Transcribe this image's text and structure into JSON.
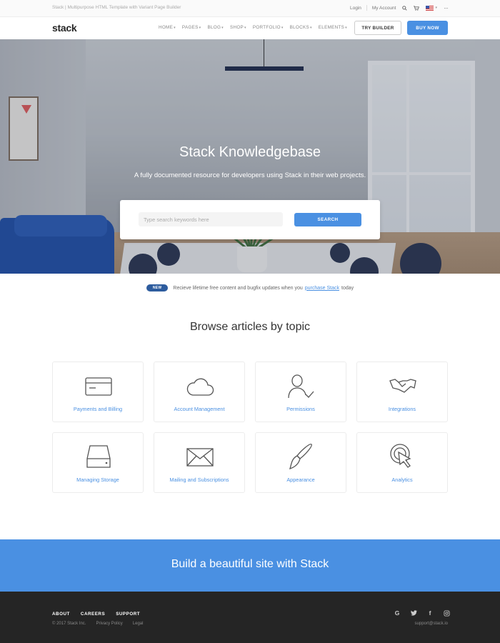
{
  "utility_bar": {
    "tagline": "Stack | Multipurpose HTML Template with Variant Page Builder",
    "login": "Login",
    "my_account": "My Account"
  },
  "nav": {
    "logo": "stack",
    "menu": [
      "HOME",
      "PAGES",
      "BLOG",
      "SHOP",
      "PORTFOLIO",
      "BLOCKS",
      "ELEMENTS"
    ],
    "try_builder": "TRY BUILDER",
    "buy_now": "BUY NOW"
  },
  "hero": {
    "title": "Stack Knowledgebase",
    "subtitle": "A fully documented resource for developers using Stack in their web projects.",
    "search_placeholder": "Type search keywords here",
    "search_button": "SEARCH"
  },
  "notice": {
    "badge": "NEW",
    "text_before": "Recieve lifetime free content and bugfix updates when you",
    "link": "purchase Stack",
    "text_after": "today"
  },
  "browse": {
    "title": "Browse articles by topic",
    "topics": [
      {
        "label": "Payments and Billing",
        "icon": "credit-card-icon"
      },
      {
        "label": "Account Management",
        "icon": "cloud-icon"
      },
      {
        "label": "Permissions",
        "icon": "user-check-icon"
      },
      {
        "label": "Integrations",
        "icon": "handshake-icon"
      },
      {
        "label": "Managing Storage",
        "icon": "hard-drive-icon"
      },
      {
        "label": "Mailing and Subscriptions",
        "icon": "envelope-icon"
      },
      {
        "label": "Appearance",
        "icon": "paintbrush-icon"
      },
      {
        "label": "Analytics",
        "icon": "target-cursor-icon"
      }
    ]
  },
  "cta": {
    "text": "Build a beautiful site with Stack"
  },
  "footer": {
    "links": [
      "ABOUT",
      "CAREERS",
      "SUPPORT"
    ],
    "copyright": "© 2017 Stack Inc.",
    "privacy": "Privacy Policy",
    "legal": "Legal",
    "email": "support@stack.io",
    "social": [
      "google-icon",
      "twitter-icon",
      "facebook-icon",
      "instagram-icon"
    ]
  },
  "colors": {
    "accent": "#4a90e2",
    "badge": "#2d5c9e",
    "footer_bg": "#252525"
  }
}
